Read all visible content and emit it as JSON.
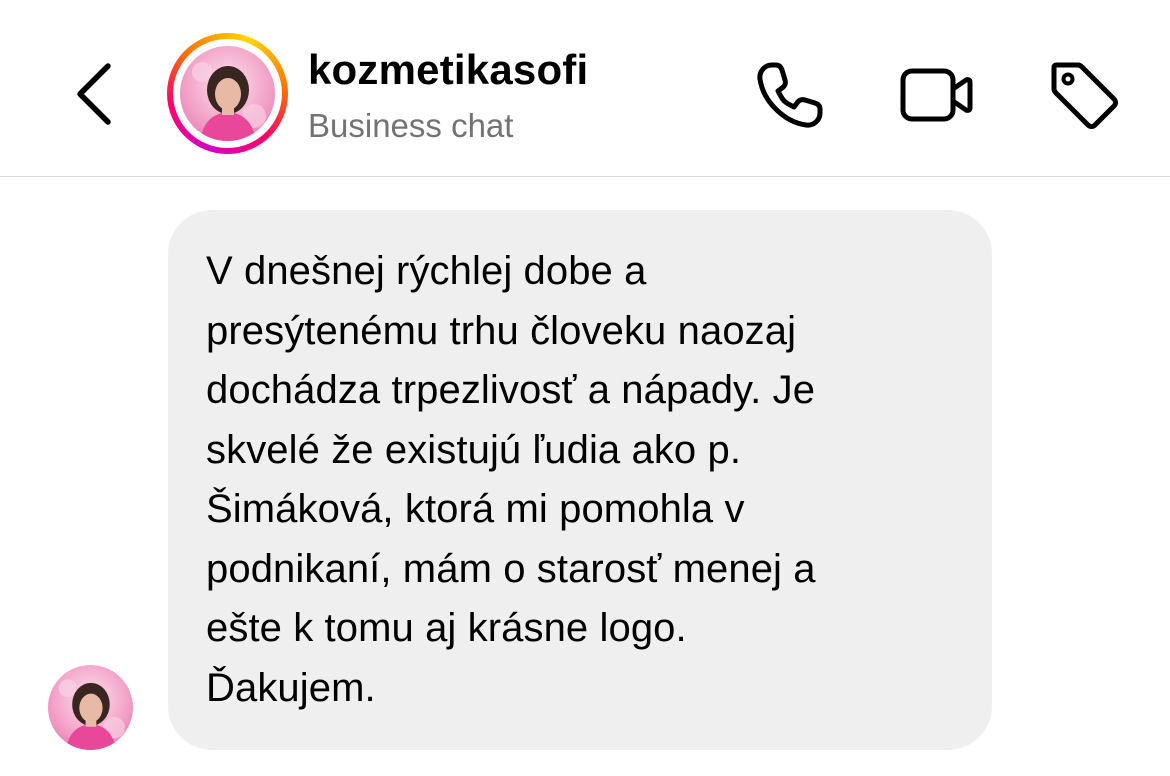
{
  "header": {
    "username": "kozmetikasofi",
    "subtitle": "Business chat",
    "icons": {
      "back": "chevron-left-icon",
      "call": "phone-icon",
      "video": "video-camera-icon",
      "tag": "tag-icon"
    }
  },
  "message": {
    "sender": "kozmetikasofi",
    "text": "V dnešnej rýchlej dobe a\npresýtenému trhu človeku naozaj\ndochádza trpezlivosť a nápady. Je\nskvelé že existujú ľudia ako p.\nŠimáková, ktorá mi pomohla v\npodnikaní, mám o starosť menej a\nešte k tomu aj krásne logo.\nĎakujem."
  },
  "colors": {
    "bubble": "#efefef",
    "subtitle": "#737373",
    "divider": "#dbdbdb",
    "story_ring": [
      "#d300c5",
      "#ff0069",
      "#ff7a00",
      "#ffd600"
    ]
  }
}
